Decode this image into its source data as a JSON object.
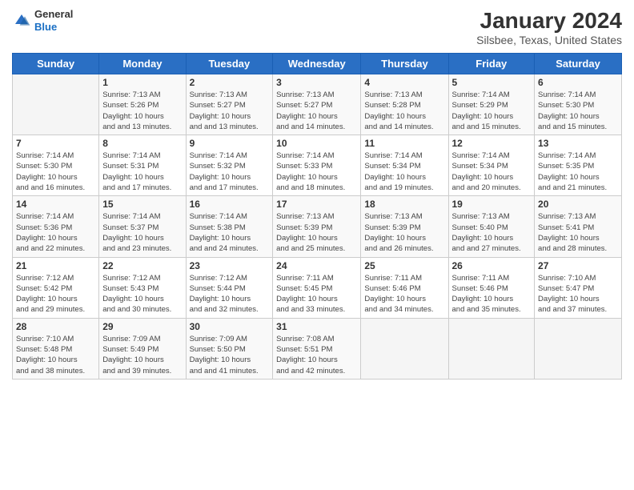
{
  "header": {
    "logo": {
      "general": "General",
      "blue": "Blue"
    },
    "title": "January 2024",
    "subtitle": "Silsbee, Texas, United States"
  },
  "calendar": {
    "days_of_week": [
      "Sunday",
      "Monday",
      "Tuesday",
      "Wednesday",
      "Thursday",
      "Friday",
      "Saturday"
    ],
    "weeks": [
      [
        {
          "day": "",
          "sunrise": "",
          "sunset": "",
          "daylight": ""
        },
        {
          "day": "1",
          "sunrise": "Sunrise: 7:13 AM",
          "sunset": "Sunset: 5:26 PM",
          "daylight": "Daylight: 10 hours and 13 minutes."
        },
        {
          "day": "2",
          "sunrise": "Sunrise: 7:13 AM",
          "sunset": "Sunset: 5:27 PM",
          "daylight": "Daylight: 10 hours and 13 minutes."
        },
        {
          "day": "3",
          "sunrise": "Sunrise: 7:13 AM",
          "sunset": "Sunset: 5:27 PM",
          "daylight": "Daylight: 10 hours and 14 minutes."
        },
        {
          "day": "4",
          "sunrise": "Sunrise: 7:13 AM",
          "sunset": "Sunset: 5:28 PM",
          "daylight": "Daylight: 10 hours and 14 minutes."
        },
        {
          "day": "5",
          "sunrise": "Sunrise: 7:14 AM",
          "sunset": "Sunset: 5:29 PM",
          "daylight": "Daylight: 10 hours and 15 minutes."
        },
        {
          "day": "6",
          "sunrise": "Sunrise: 7:14 AM",
          "sunset": "Sunset: 5:30 PM",
          "daylight": "Daylight: 10 hours and 15 minutes."
        }
      ],
      [
        {
          "day": "7",
          "sunrise": "Sunrise: 7:14 AM",
          "sunset": "Sunset: 5:30 PM",
          "daylight": "Daylight: 10 hours and 16 minutes."
        },
        {
          "day": "8",
          "sunrise": "Sunrise: 7:14 AM",
          "sunset": "Sunset: 5:31 PM",
          "daylight": "Daylight: 10 hours and 17 minutes."
        },
        {
          "day": "9",
          "sunrise": "Sunrise: 7:14 AM",
          "sunset": "Sunset: 5:32 PM",
          "daylight": "Daylight: 10 hours and 17 minutes."
        },
        {
          "day": "10",
          "sunrise": "Sunrise: 7:14 AM",
          "sunset": "Sunset: 5:33 PM",
          "daylight": "Daylight: 10 hours and 18 minutes."
        },
        {
          "day": "11",
          "sunrise": "Sunrise: 7:14 AM",
          "sunset": "Sunset: 5:34 PM",
          "daylight": "Daylight: 10 hours and 19 minutes."
        },
        {
          "day": "12",
          "sunrise": "Sunrise: 7:14 AM",
          "sunset": "Sunset: 5:34 PM",
          "daylight": "Daylight: 10 hours and 20 minutes."
        },
        {
          "day": "13",
          "sunrise": "Sunrise: 7:14 AM",
          "sunset": "Sunset: 5:35 PM",
          "daylight": "Daylight: 10 hours and 21 minutes."
        }
      ],
      [
        {
          "day": "14",
          "sunrise": "Sunrise: 7:14 AM",
          "sunset": "Sunset: 5:36 PM",
          "daylight": "Daylight: 10 hours and 22 minutes."
        },
        {
          "day": "15",
          "sunrise": "Sunrise: 7:14 AM",
          "sunset": "Sunset: 5:37 PM",
          "daylight": "Daylight: 10 hours and 23 minutes."
        },
        {
          "day": "16",
          "sunrise": "Sunrise: 7:14 AM",
          "sunset": "Sunset: 5:38 PM",
          "daylight": "Daylight: 10 hours and 24 minutes."
        },
        {
          "day": "17",
          "sunrise": "Sunrise: 7:13 AM",
          "sunset": "Sunset: 5:39 PM",
          "daylight": "Daylight: 10 hours and 25 minutes."
        },
        {
          "day": "18",
          "sunrise": "Sunrise: 7:13 AM",
          "sunset": "Sunset: 5:39 PM",
          "daylight": "Daylight: 10 hours and 26 minutes."
        },
        {
          "day": "19",
          "sunrise": "Sunrise: 7:13 AM",
          "sunset": "Sunset: 5:40 PM",
          "daylight": "Daylight: 10 hours and 27 minutes."
        },
        {
          "day": "20",
          "sunrise": "Sunrise: 7:13 AM",
          "sunset": "Sunset: 5:41 PM",
          "daylight": "Daylight: 10 hours and 28 minutes."
        }
      ],
      [
        {
          "day": "21",
          "sunrise": "Sunrise: 7:12 AM",
          "sunset": "Sunset: 5:42 PM",
          "daylight": "Daylight: 10 hours and 29 minutes."
        },
        {
          "day": "22",
          "sunrise": "Sunrise: 7:12 AM",
          "sunset": "Sunset: 5:43 PM",
          "daylight": "Daylight: 10 hours and 30 minutes."
        },
        {
          "day": "23",
          "sunrise": "Sunrise: 7:12 AM",
          "sunset": "Sunset: 5:44 PM",
          "daylight": "Daylight: 10 hours and 32 minutes."
        },
        {
          "day": "24",
          "sunrise": "Sunrise: 7:11 AM",
          "sunset": "Sunset: 5:45 PM",
          "daylight": "Daylight: 10 hours and 33 minutes."
        },
        {
          "day": "25",
          "sunrise": "Sunrise: 7:11 AM",
          "sunset": "Sunset: 5:46 PM",
          "daylight": "Daylight: 10 hours and 34 minutes."
        },
        {
          "day": "26",
          "sunrise": "Sunrise: 7:11 AM",
          "sunset": "Sunset: 5:46 PM",
          "daylight": "Daylight: 10 hours and 35 minutes."
        },
        {
          "day": "27",
          "sunrise": "Sunrise: 7:10 AM",
          "sunset": "Sunset: 5:47 PM",
          "daylight": "Daylight: 10 hours and 37 minutes."
        }
      ],
      [
        {
          "day": "28",
          "sunrise": "Sunrise: 7:10 AM",
          "sunset": "Sunset: 5:48 PM",
          "daylight": "Daylight: 10 hours and 38 minutes."
        },
        {
          "day": "29",
          "sunrise": "Sunrise: 7:09 AM",
          "sunset": "Sunset: 5:49 PM",
          "daylight": "Daylight: 10 hours and 39 minutes."
        },
        {
          "day": "30",
          "sunrise": "Sunrise: 7:09 AM",
          "sunset": "Sunset: 5:50 PM",
          "daylight": "Daylight: 10 hours and 41 minutes."
        },
        {
          "day": "31",
          "sunrise": "Sunrise: 7:08 AM",
          "sunset": "Sunset: 5:51 PM",
          "daylight": "Daylight: 10 hours and 42 minutes."
        },
        {
          "day": "",
          "sunrise": "",
          "sunset": "",
          "daylight": ""
        },
        {
          "day": "",
          "sunrise": "",
          "sunset": "",
          "daylight": ""
        },
        {
          "day": "",
          "sunrise": "",
          "sunset": "",
          "daylight": ""
        }
      ]
    ]
  }
}
